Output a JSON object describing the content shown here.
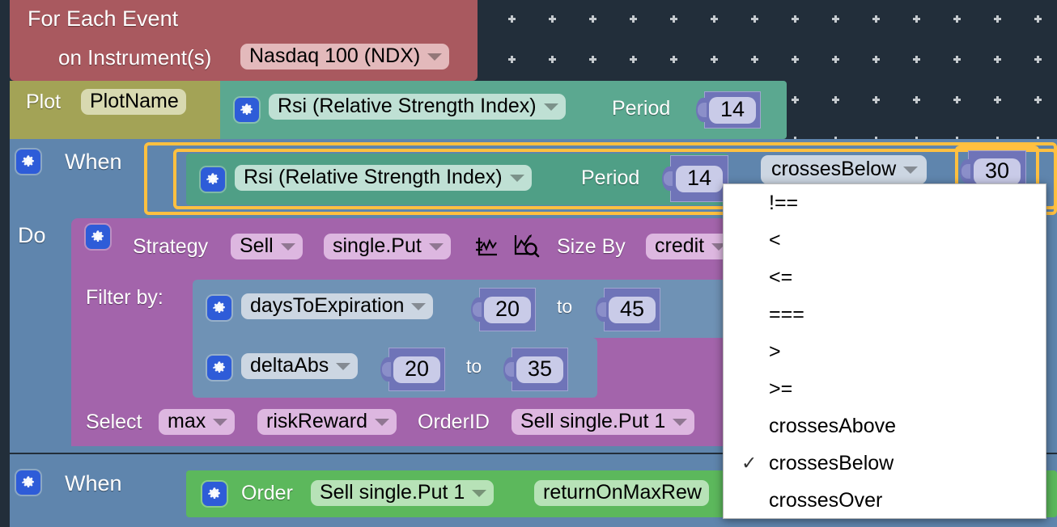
{
  "app": {
    "background_color": "#222e3a",
    "grid_dot_color": "#c5cace",
    "selection_color": "#ffc040"
  },
  "blocks": {
    "for_each_event": {
      "color": "#a9595f",
      "title": "For Each Event",
      "row2_label": "on Instrument(s)",
      "instrument_value": "Nasdaq 100 (NDX)"
    },
    "plot": {
      "color": "#a3a356",
      "label": "Plot",
      "name_value": "PlotName",
      "indicator": {
        "color": "#5ba890",
        "value": "Rsi (Relative Strength Index)",
        "period_label": "Period",
        "period_value": "14"
      }
    },
    "when_rsi": {
      "color": "#5f85ad",
      "label": "When",
      "indicator": {
        "color": "#4f9f86",
        "value": "Rsi (Relative Strength Index)",
        "period_label": "Period",
        "period_value": "14"
      },
      "comparator_value": "crossesBelow",
      "threshold_value": "30"
    },
    "do": {
      "label": "Do"
    },
    "strategy": {
      "color": "#a364ab",
      "label": "Strategy",
      "action_value": "Sell",
      "structure_value": "single.Put",
      "chart_icon": "plot-chart-icon",
      "analyze_icon": "chart-magnifier-icon",
      "size_by_label": "Size By",
      "size_by_value": "credit"
    },
    "filter": {
      "label": "Filter by:",
      "color": "#6f92b5",
      "rows": [
        {
          "field": "daysToExpiration",
          "from": "20",
          "to_label": "to",
          "to": "45"
        },
        {
          "field": "deltaAbs",
          "from": "20",
          "to_label": "to",
          "to": "35"
        }
      ]
    },
    "select": {
      "label": "Select",
      "agg_value": "max",
      "metric_value": "riskReward",
      "orderid_label": "OrderID",
      "orderid_value": "Sell single.Put 1"
    },
    "when_order": {
      "color": "#5f85ad",
      "label": "When",
      "order_block_color": "#5cb85c",
      "order_label": "Order",
      "order_value": "Sell single.Put 1",
      "metric_value": "returnOnMaxRew"
    }
  },
  "dropdown_menu": {
    "selected": "crossesBelow",
    "check_glyph": "✓",
    "items": [
      {
        "label": "!==",
        "checked": false
      },
      {
        "label": "<",
        "checked": false
      },
      {
        "label": "<=",
        "checked": false
      },
      {
        "label": "===",
        "checked": false
      },
      {
        "label": ">",
        "checked": false
      },
      {
        "label": ">=",
        "checked": false
      },
      {
        "label": "crossesAbove",
        "checked": false
      },
      {
        "label": "crossesBelow",
        "checked": true
      },
      {
        "label": "crossesOver",
        "checked": false
      }
    ]
  }
}
